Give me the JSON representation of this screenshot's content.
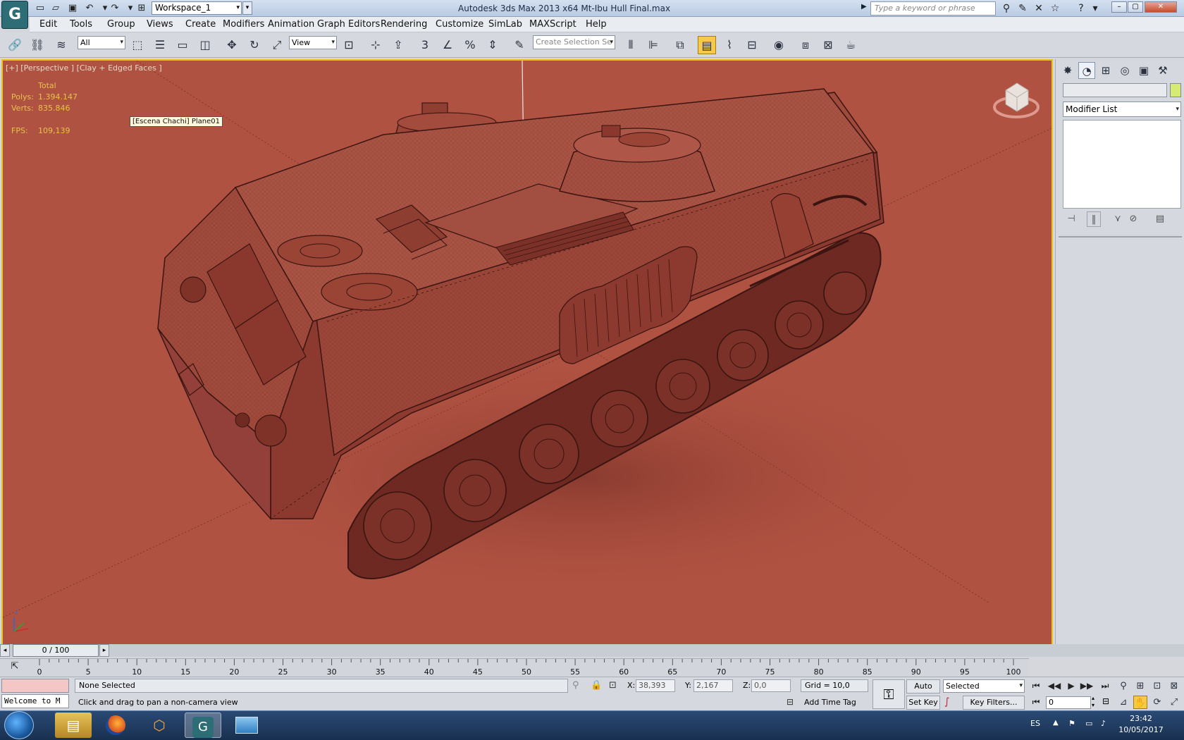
{
  "app": {
    "title": "Autodesk 3ds Max  2013 x64     Mt-Ibu Hull Final.max",
    "logo_glyph": "G",
    "workspace": "Workspace_1",
    "search_placeholder": "Type a keyword or phrase"
  },
  "menu": [
    "Edit",
    "Tools",
    "Group",
    "Views",
    "Create",
    "Modifiers",
    "Animation",
    "Graph Editors",
    "Rendering",
    "Customize",
    "SimLab",
    "MAXScript",
    "Help"
  ],
  "toolbar": {
    "selection_filter": "All",
    "reference_coord": "View",
    "selection_set_placeholder": "Create Selection Se"
  },
  "viewport": {
    "label": "[+] [Perspective ] [Clay + Edged Faces ]",
    "stats_header": "Total",
    "polys_label": "Polys:",
    "polys_value": "1.394.147",
    "verts_label": "Verts:",
    "verts_value": "835.846",
    "fps_label": "FPS:",
    "fps_value": "109,139",
    "tooltip": "[Escena Chachi] Plane01",
    "background_color": "#b05242",
    "border_color": "#e7c419",
    "axis_z": "z"
  },
  "command_panel": {
    "modifier_list": "Modifier List",
    "name_field": ""
  },
  "time": {
    "slider_label": "0 / 100",
    "ticks": [
      "0",
      "5",
      "10",
      "15",
      "20",
      "25",
      "30",
      "35",
      "40",
      "45",
      "50",
      "55",
      "60",
      "65",
      "70",
      "75",
      "80",
      "85",
      "90",
      "95",
      "100"
    ]
  },
  "status": {
    "welcome": "Welcome to M",
    "selection": "None Selected",
    "prompt": "Click and drag to pan a non-camera view",
    "x_label": "X:",
    "x_value": "38,393",
    "y_label": "Y:",
    "y_value": "2,167",
    "z_label": "Z:",
    "z_value": "0,0",
    "grid": "Grid = 10,0",
    "add_time_tag": "Add Time Tag",
    "auto_key": "Auto Key",
    "set_key": "Set Key",
    "selected": "Selected",
    "key_filters": "Key Filters...",
    "current_frame": "0"
  },
  "taskbar": {
    "language": "ES",
    "time": "23:42",
    "date": "10/05/2017"
  }
}
